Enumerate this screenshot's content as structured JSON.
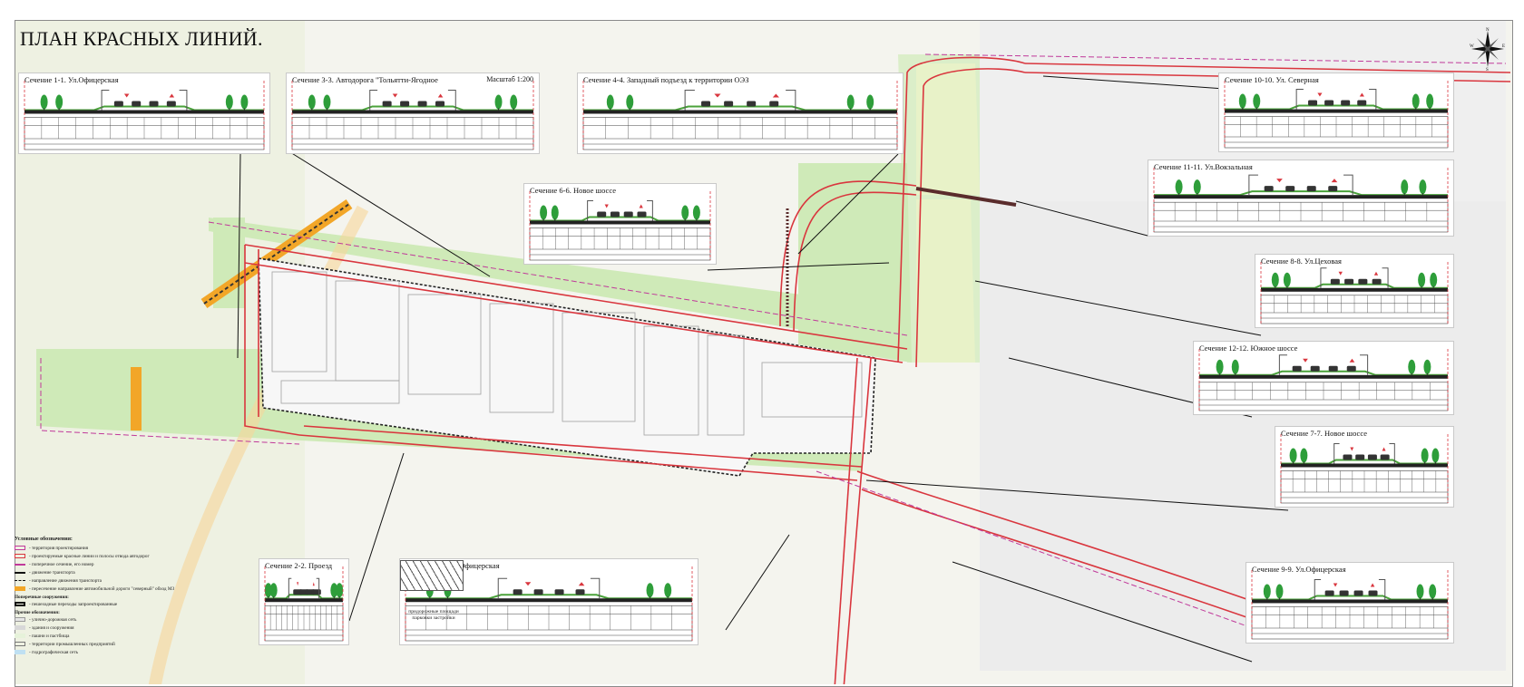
{
  "title": "ПЛАН КРАСНЫХ ЛИНИЙ.",
  "compass_letters": {
    "n": "N",
    "s": "S",
    "e": "E",
    "w": "W"
  },
  "colors": {
    "background": "#f4f4ee",
    "green_zone": "#cfeab8",
    "green_light": "#e6f2da",
    "red_line": "#d9363e",
    "magenta_line": "#c0399a",
    "orange_road": "#f2a628",
    "building_fill": "#f0f0f0",
    "block_outline": "#9a9a9a"
  },
  "sections": [
    {
      "id": "s1",
      "title": "Сечение 1-1. Ул.Офицерская"
    },
    {
      "id": "s3",
      "title": "Сечение 3-3. Автодорога \"Тольятти-Ягодное",
      "scale": "Масштаб 1:200"
    },
    {
      "id": "s4",
      "title": "Сечение 4-4. Западный подъезд к территории ОЭЗ"
    },
    {
      "id": "s10",
      "title": "Сечение 10-10. Ул. Северная"
    },
    {
      "id": "s11",
      "title": "Сечение 11-11. Ул.Вокзальная"
    },
    {
      "id": "s6",
      "title": "Сечение 6-6. Новое шоссе"
    },
    {
      "id": "s8",
      "title": "Сечение 8-8. Ул.Цеховая"
    },
    {
      "id": "s12",
      "title": "Сечение 12-12. Южное шоссе"
    },
    {
      "id": "s7",
      "title": "Сечение 7-7. Новое шоссе"
    },
    {
      "id": "s2",
      "title": "Сечение 2-2. Проезд"
    },
    {
      "id": "s5",
      "title": "Сечение 5-5. Ул.Офицерская"
    },
    {
      "id": "s9",
      "title": "Сечение 9-9. Ул.Офицерская"
    }
  ],
  "legend": {
    "heading": "Условные обозначения:",
    "items": [
      "- территория проектирования",
      "- проектируемые красные линии и полосы отвода автодорог",
      "- поперечное сечение, его номер",
      "- движение транспорта",
      "- направление движения транспорта",
      "- пересечение направление автомобильной дороги \"северный\" обход МЗ"
    ],
    "sub1": "Поперечные сооружения:",
    "sub1_items": [
      "- пешеходные переходы запроектированные"
    ],
    "sub2": "Прочие обозначения:",
    "sub2_items": [
      "- улично-дорожная сеть",
      "- здания и сооружения",
      "- пашни и пастбища",
      "- территории промышленных предприятий",
      "- гидрографическая сеть"
    ]
  },
  "hatch_note": "придорожные площади парковки застройки"
}
